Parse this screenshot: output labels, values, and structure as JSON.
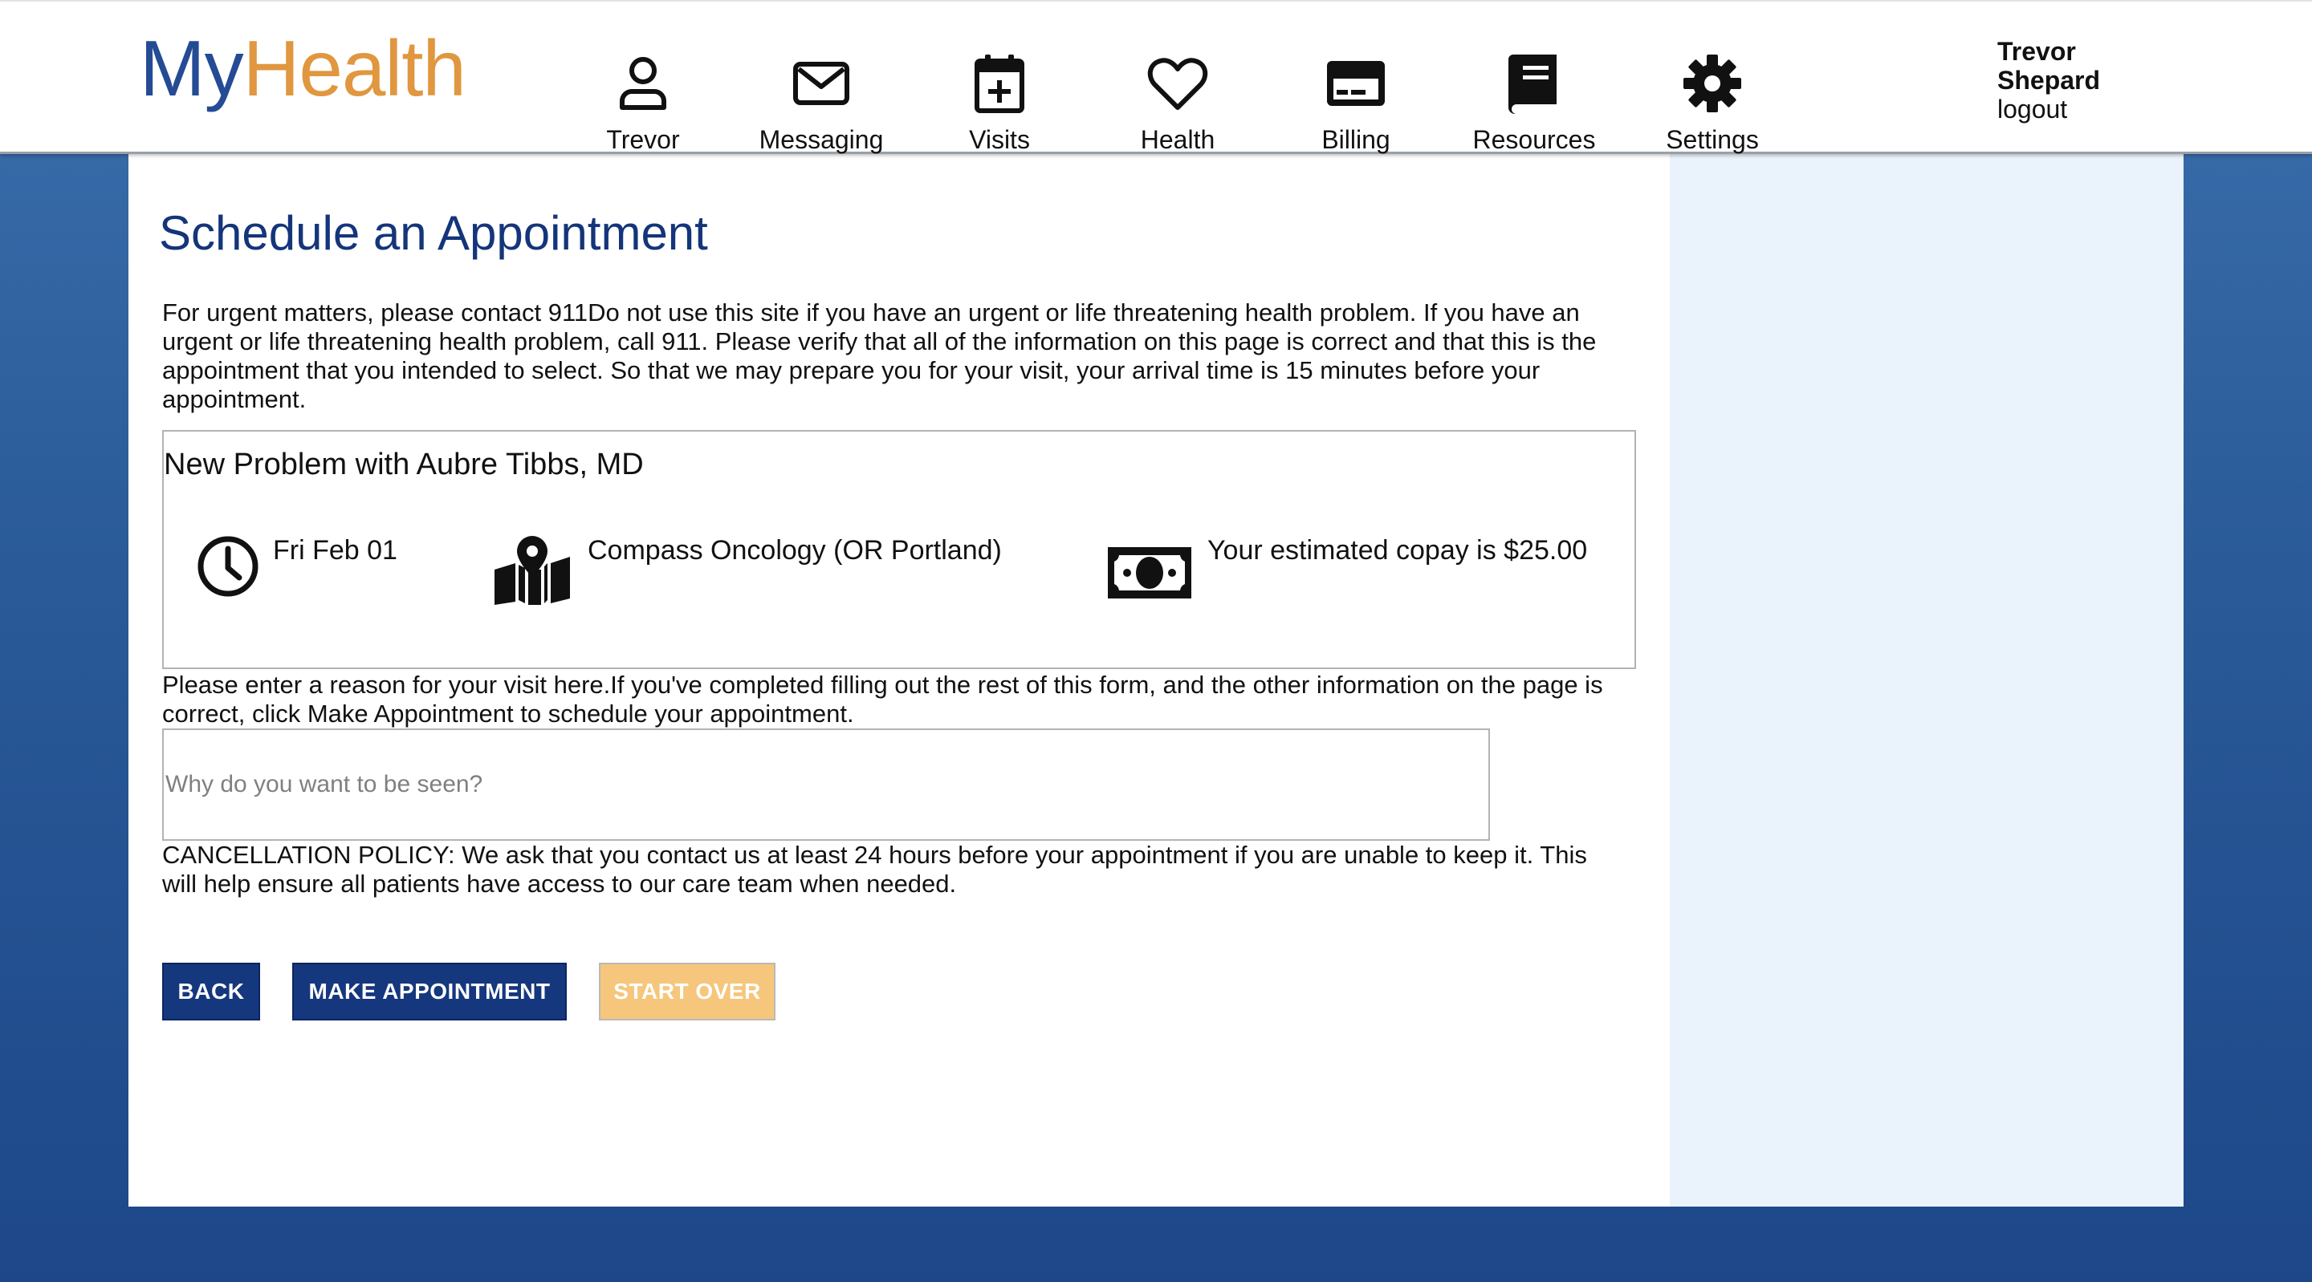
{
  "app": {
    "logo_part1": "My",
    "logo_part2": "Health"
  },
  "nav": {
    "items": [
      {
        "label": "Trevor",
        "icon": "person-icon"
      },
      {
        "label": "Messaging",
        "icon": "envelope-icon"
      },
      {
        "label": "Visits",
        "icon": "calendar-plus-icon"
      },
      {
        "label": "Health",
        "icon": "heart-icon"
      },
      {
        "label": "Billing",
        "icon": "credit-card-icon"
      },
      {
        "label": "Resources",
        "icon": "book-icon"
      },
      {
        "label": "Settings",
        "icon": "gear-icon"
      }
    ]
  },
  "user": {
    "name": "Trevor Shepard",
    "logout": "logout"
  },
  "page": {
    "title": "Schedule an Appointment",
    "intro": "For urgent matters, please contact 911Do not use this site if you have an urgent or life threatening health problem. If you have an urgent or life threatening health problem, call 911. Please verify that all of the information on this page is correct and that this is the appointment that you intended to select. So that we may prepare you for your visit, your arrival time is 15 minutes before your appointment."
  },
  "appointment": {
    "title": "New Problem with Aubre Tibbs, MD",
    "date": "Fri Feb 01",
    "location": "Compass Oncology (OR Portland)",
    "copay": "Your estimated copay is $25.00"
  },
  "reason": {
    "instructions": "Please enter a reason for your visit here.If you've completed filling out the rest of this form, and the other information on the page is correct, click Make Appointment to schedule your appointment.",
    "placeholder": "Why do you want to be seen?",
    "value": ""
  },
  "policy": {
    "text": "CANCELLATION POLICY: We ask that you contact us at least 24 hours before your appointment if you are unable to keep it. This will help ensure all patients have access to our care team when needed."
  },
  "buttons": {
    "back": "BACK",
    "make": "MAKE APPOINTMENT",
    "start_over": "START OVER"
  },
  "colors": {
    "brand_blue": "#244b94",
    "brand_orange": "#e0973f",
    "title_blue": "#14357a",
    "button_blue": "#15377e",
    "button_orange": "#f5c67c",
    "side_panel": "#eaf2fb"
  }
}
